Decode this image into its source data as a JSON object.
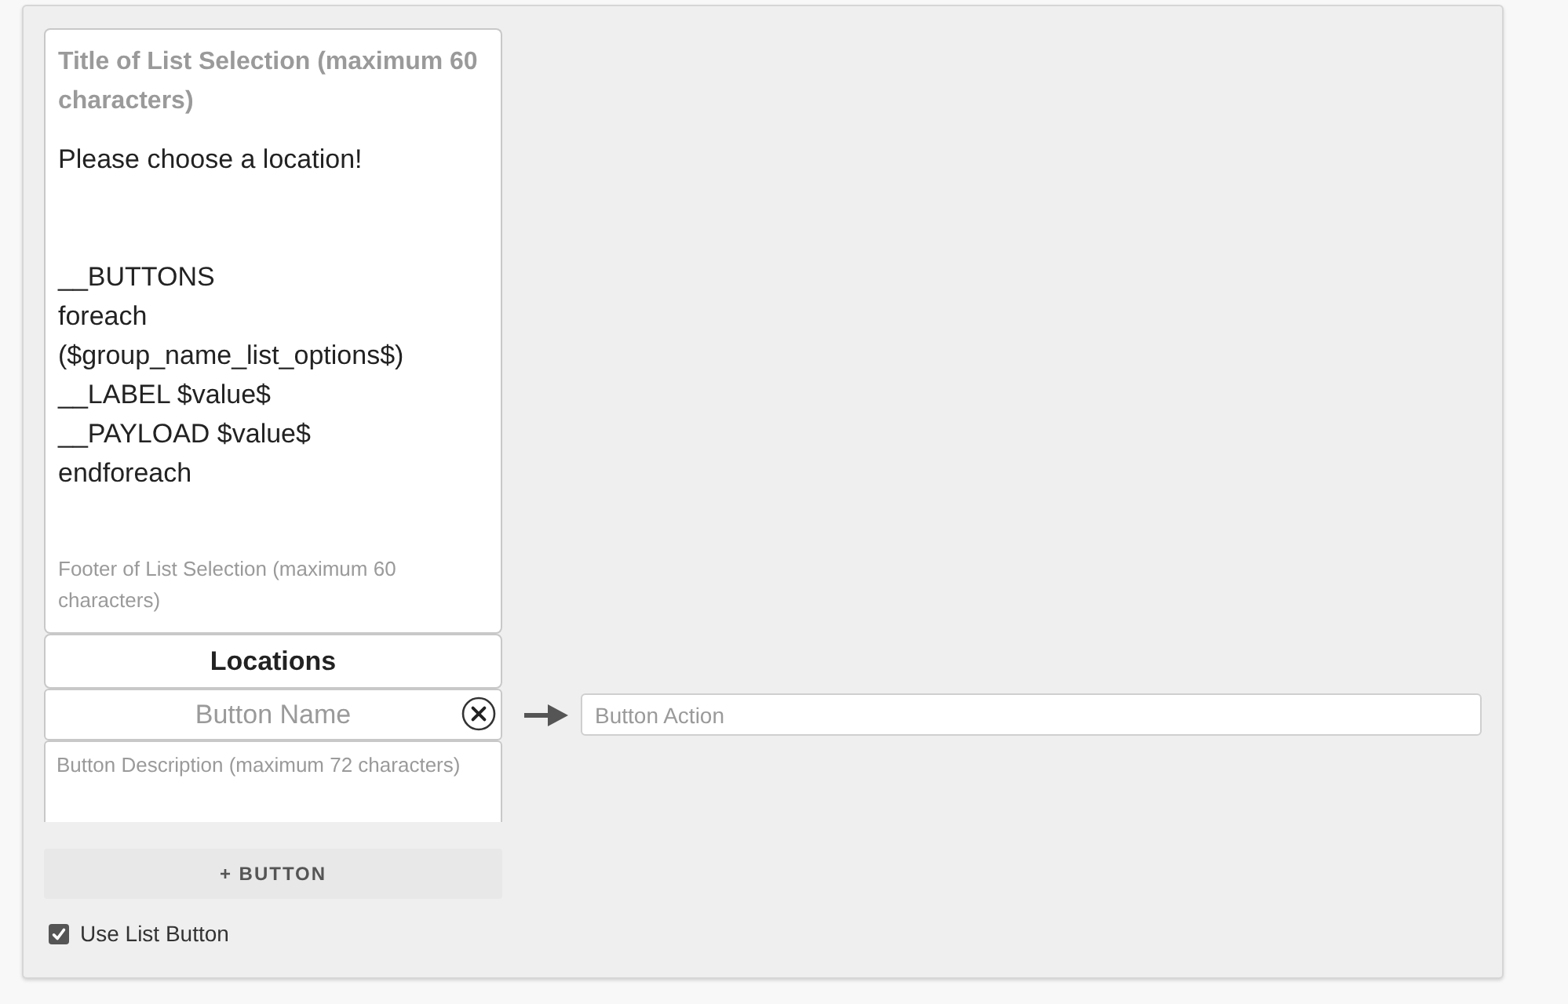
{
  "list_selection": {
    "title": {
      "placeholder": "Title of List Selection (maximum 60 characters)"
    },
    "message": {
      "value": "Please choose a location!\n\n\n__BUTTONS\nforeach ($group_name_list_options$)\n__LABEL $value$\n__PAYLOAD $value$\nendforeach"
    },
    "footer": {
      "placeholder": "Footer of List Selection (maximum 60 characters)"
    }
  },
  "section": {
    "title": "Locations"
  },
  "list_buttons": [
    {
      "name": {
        "placeholder": "Button Name"
      },
      "action": {
        "placeholder": "Button Action"
      },
      "description": {
        "placeholder": "Button Description (maximum 72 characters)"
      }
    }
  ],
  "add_button": {
    "label": "+ BUTTON"
  },
  "use_list_button": {
    "label": "Use List Button",
    "checked": true
  }
}
